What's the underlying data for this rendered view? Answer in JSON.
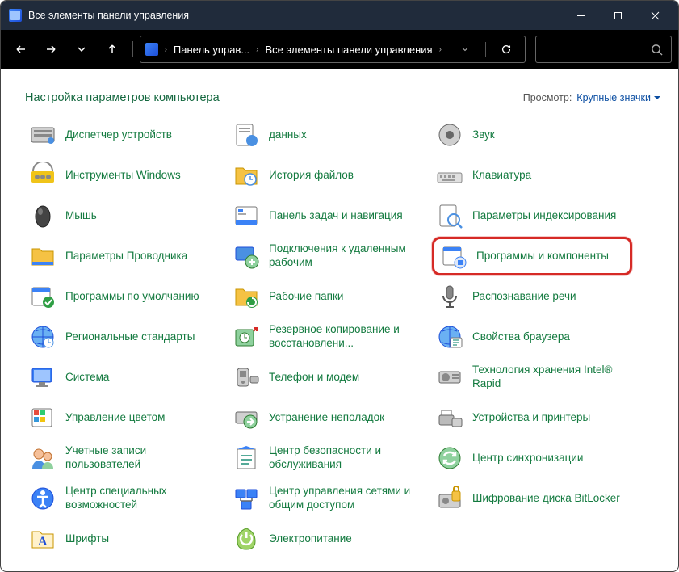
{
  "window": {
    "title": "Все элементы панели управления"
  },
  "breadcrumb": {
    "seg1": "Панель управ...",
    "seg2": "Все элементы панели управления"
  },
  "header": {
    "page_title": "Настройка параметров компьютера",
    "view_label": "Просмотр:",
    "view_value": "Крупные значки"
  },
  "items": [
    {
      "label": "Диспетчер устройств",
      "icon": "device-manager"
    },
    {
      "label": "данных",
      "icon": "data"
    },
    {
      "label": "Звук",
      "icon": "sound"
    },
    {
      "label": "Инструменты Windows",
      "icon": "tools"
    },
    {
      "label": "История файлов",
      "icon": "file-history"
    },
    {
      "label": "Клавиатура",
      "icon": "keyboard"
    },
    {
      "label": "Мышь",
      "icon": "mouse"
    },
    {
      "label": "Панель задач и навигация",
      "icon": "taskbar"
    },
    {
      "label": "Параметры индексирования",
      "icon": "indexing"
    },
    {
      "label": "Параметры Проводника",
      "icon": "explorer-options"
    },
    {
      "label": "Подключения к удаленным рабочим",
      "icon": "remote"
    },
    {
      "label": "Программы и компоненты",
      "icon": "programs",
      "highlight": true
    },
    {
      "label": "Программы по умолчанию",
      "icon": "default-programs"
    },
    {
      "label": "Рабочие папки",
      "icon": "work-folders"
    },
    {
      "label": "Распознавание речи",
      "icon": "speech"
    },
    {
      "label": "Региональные стандарты",
      "icon": "region"
    },
    {
      "label": "Резервное копирование и восстановлени...",
      "icon": "backup"
    },
    {
      "label": "Свойства браузера",
      "icon": "internet-options"
    },
    {
      "label": "Система",
      "icon": "system"
    },
    {
      "label": "Телефон и модем",
      "icon": "phone"
    },
    {
      "label": "Технология хранения Intel® Rapid",
      "icon": "intel-rapid"
    },
    {
      "label": "Управление цветом",
      "icon": "color"
    },
    {
      "label": "Устранение неполадок",
      "icon": "troubleshoot"
    },
    {
      "label": "Устройства и принтеры",
      "icon": "devices-printers"
    },
    {
      "label": "Учетные записи пользователей",
      "icon": "user-accounts"
    },
    {
      "label": "Центр безопасности и обслуживания",
      "icon": "security-center"
    },
    {
      "label": "Центр синхронизации",
      "icon": "sync-center"
    },
    {
      "label": "Центр специальных возможностей",
      "icon": "ease-of-access"
    },
    {
      "label": "Центр управления сетями и общим доступом",
      "icon": "network-sharing"
    },
    {
      "label": "Шифрование диска BitLocker",
      "icon": "bitlocker"
    },
    {
      "label": "Шрифты",
      "icon": "fonts"
    },
    {
      "label": "Электропитание",
      "icon": "power"
    }
  ]
}
